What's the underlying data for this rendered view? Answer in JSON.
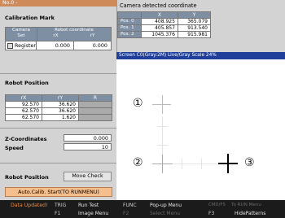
{
  "left": {
    "title": "No.0 -",
    "calibration_mark": {
      "label": "Calibration Mark",
      "col1_line1": "Camera",
      "col1_line2": "Set",
      "col2_line1": "Robot coordinate",
      "col2_x": "rX",
      "col2_y": "rY",
      "register_label": "Register",
      "rx": "0.000",
      "ry": "0.000"
    },
    "robot_position": {
      "label": "Robot Position",
      "headers": [
        "rX",
        "rY",
        "R"
      ],
      "rows": [
        [
          "92.570",
          "36.620",
          ""
        ],
        [
          "62.570",
          "36.620",
          ""
        ],
        [
          "62.570",
          "1.620",
          ""
        ]
      ]
    },
    "z_coordinates": {
      "label": "Z-Coordinates",
      "value": "0.000"
    },
    "speed": {
      "label": "Speed",
      "value": "10"
    },
    "robot_position_bottom": {
      "label": "Robot Position",
      "button": "Move Check"
    },
    "auto_calib_button": "Auto.Calib. Start(TO RUNMENU)"
  },
  "right": {
    "title": "Camera detected coordinate",
    "col_x": "X",
    "col_y": "Y",
    "rows": [
      {
        "label": "Pos. 0",
        "x": "408.925",
        "y": "365.079"
      },
      {
        "label": "Pos. 1",
        "x": "405.857",
        "y": "913.540"
      },
      {
        "label": "Pos. 2",
        "x": "1045.376",
        "y": "915.981"
      }
    ],
    "screen_bar": "Screen C0(Gray:2M)   Live/Gray Scale 24%",
    "markers": [
      "①",
      "②",
      "③"
    ]
  },
  "status": {
    "data_updated": "Data Updated!",
    "trig_key": "TRIG",
    "trig_label": "Run Test",
    "func_key": "FUNC",
    "func_label": "Pop-up Menu",
    "cmd_key": "CMD/F5",
    "cmd_label": "To RUN Menu",
    "f1_key": "F1",
    "f1_label": "Image Menu",
    "f2_key": "F2",
    "f2_label": "Select Menu",
    "f3_key": "F3",
    "f3_label": "HidePatterns"
  }
}
